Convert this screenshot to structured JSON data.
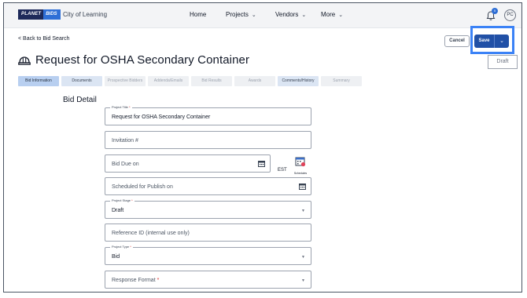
{
  "topnav": {
    "logo_part1": "PLANET",
    "logo_part2": "BIDS",
    "org_name": "City of Learning",
    "items": [
      {
        "label": "Home",
        "has_caret": false
      },
      {
        "label": "Projects",
        "has_caret": true
      },
      {
        "label": "Vendors",
        "has_caret": true
      },
      {
        "label": "More",
        "has_caret": true
      }
    ],
    "notification_count": "5",
    "avatar_initials": "PC"
  },
  "header": {
    "back_label": "< Back to Bid Search",
    "title": "Request for OSHA Secondary Container",
    "cancel_label": "Cancel",
    "save_label": "Save",
    "save_menu_option": "Draft"
  },
  "tabs": [
    {
      "label": "Bid Information",
      "state": "active"
    },
    {
      "label": "Documents",
      "state": "normal"
    },
    {
      "label": "Prospective Bidders",
      "state": "disabled"
    },
    {
      "label": "Addenda/Emails",
      "state": "disabled"
    },
    {
      "label": "Bid Results",
      "state": "disabled"
    },
    {
      "label": "Awards",
      "state": "disabled"
    },
    {
      "label": "Comments/History",
      "state": "normal"
    },
    {
      "label": "Summary",
      "state": "disabled"
    }
  ],
  "form": {
    "section_title": "Bid Detail",
    "project_title": {
      "label": "Project Title",
      "required_mark": "*",
      "value": "Request for OSHA Secondary Container"
    },
    "invitation": {
      "placeholder": "Invitation #"
    },
    "bid_due": {
      "placeholder": "Bid Due on",
      "timezone": "EST",
      "schedules_label": "Schedules"
    },
    "scheduled_publish": {
      "placeholder": "Scheduled for Publish on"
    },
    "project_stage": {
      "label": "Project Stage",
      "required_mark": "*",
      "value": "Draft"
    },
    "reference_id": {
      "placeholder": "Reference ID (internal use only)"
    },
    "project_type": {
      "label": "Project Type",
      "required_mark": "*",
      "value": "Bid"
    },
    "response_format": {
      "placeholder": "Response Format",
      "required_mark": "*"
    }
  },
  "colors": {
    "brand_dark": "#1e2a5a",
    "brand_blue": "#2f6fd6",
    "save_button": "#2150a6",
    "highlight": "#3b82f6",
    "required": "#dc2626"
  }
}
